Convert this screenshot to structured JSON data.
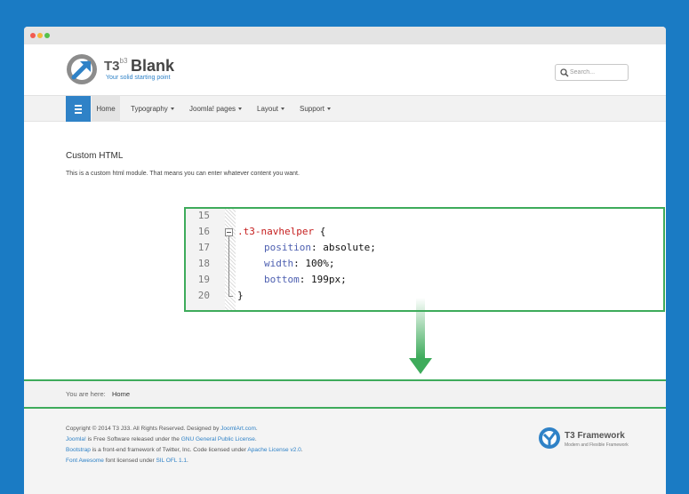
{
  "colors": {
    "background": "#1a7bc4",
    "accent": "#2f82c7",
    "highlight_border": "#3eab5b"
  },
  "header": {
    "logo_t3": "T3",
    "logo_sup": "b3",
    "logo_blank": "Blank",
    "tagline": "Your solid starting point",
    "search_placeholder": "Search..."
  },
  "nav": {
    "menu_icon": "hamburger-icon",
    "items": [
      {
        "label": "Home",
        "dropdown": false,
        "active": true
      },
      {
        "label": "Typography",
        "dropdown": true
      },
      {
        "label": "Joomla! pages",
        "dropdown": true
      },
      {
        "label": "Layout",
        "dropdown": true
      },
      {
        "label": "Support",
        "dropdown": true
      }
    ]
  },
  "module": {
    "title": "Custom HTML",
    "body": "This is a custom html module. That means you can enter whatever content you want."
  },
  "code": {
    "line_numbers": [
      "15",
      "16",
      "17",
      "18",
      "19",
      "20"
    ],
    "selector": ".t3-navhelper",
    "open_brace": " {",
    "properties": [
      {
        "name": "position",
        "value": "absolute;"
      },
      {
        "name": "width",
        "value": "100%;"
      },
      {
        "name": "bottom",
        "value": "199px;"
      }
    ],
    "close_brace": "}"
  },
  "breadcrumb": {
    "label": "You are here:",
    "home": "Home"
  },
  "footer": {
    "lines": [
      {
        "prefix": "Copyright © 2014 T3 J33. All Rights Reserved. Designed by ",
        "link": "JoomlArt.com",
        "suffix": "."
      },
      {
        "prefix": "",
        "link": "Joomla!",
        "middle": " is Free Software released under the ",
        "link2": "GNU General Public License",
        "suffix": "."
      },
      {
        "prefix": "",
        "link": "Bootstrap",
        "middle": " is a front-end framework of Twitter, Inc. Code licensed under ",
        "link2": "Apache License v2.0",
        "suffix": "."
      },
      {
        "prefix": "",
        "link": "Font Awesome",
        "middle": " font licensed under ",
        "link2": "SIL OFL 1.1",
        "suffix": "."
      }
    ],
    "brand_title": "T3 Framework",
    "brand_subtitle": "Modern and Flexible Framework"
  }
}
